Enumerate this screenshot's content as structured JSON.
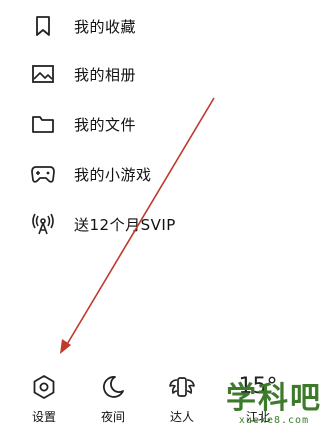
{
  "menu": {
    "items": [
      {
        "label": "我的收藏",
        "icon": "bookmark-icon"
      },
      {
        "label": "我的相册",
        "icon": "image-icon"
      },
      {
        "label": "我的文件",
        "icon": "folder-icon"
      },
      {
        "label": "我的小游戏",
        "icon": "gamepad-icon"
      },
      {
        "label": "送12个月SVIP",
        "icon": "broadcast-icon"
      }
    ]
  },
  "bottom_bar": {
    "settings_label": "设置",
    "night_label": "夜间",
    "talent_label": "达人",
    "weather_temp": "15°",
    "weather_location": "江北"
  },
  "watermark": {
    "title": "学科吧",
    "url": "xueke8.com"
  },
  "colors": {
    "arrow": "#c0392b",
    "watermark": "#3d7a2c"
  }
}
